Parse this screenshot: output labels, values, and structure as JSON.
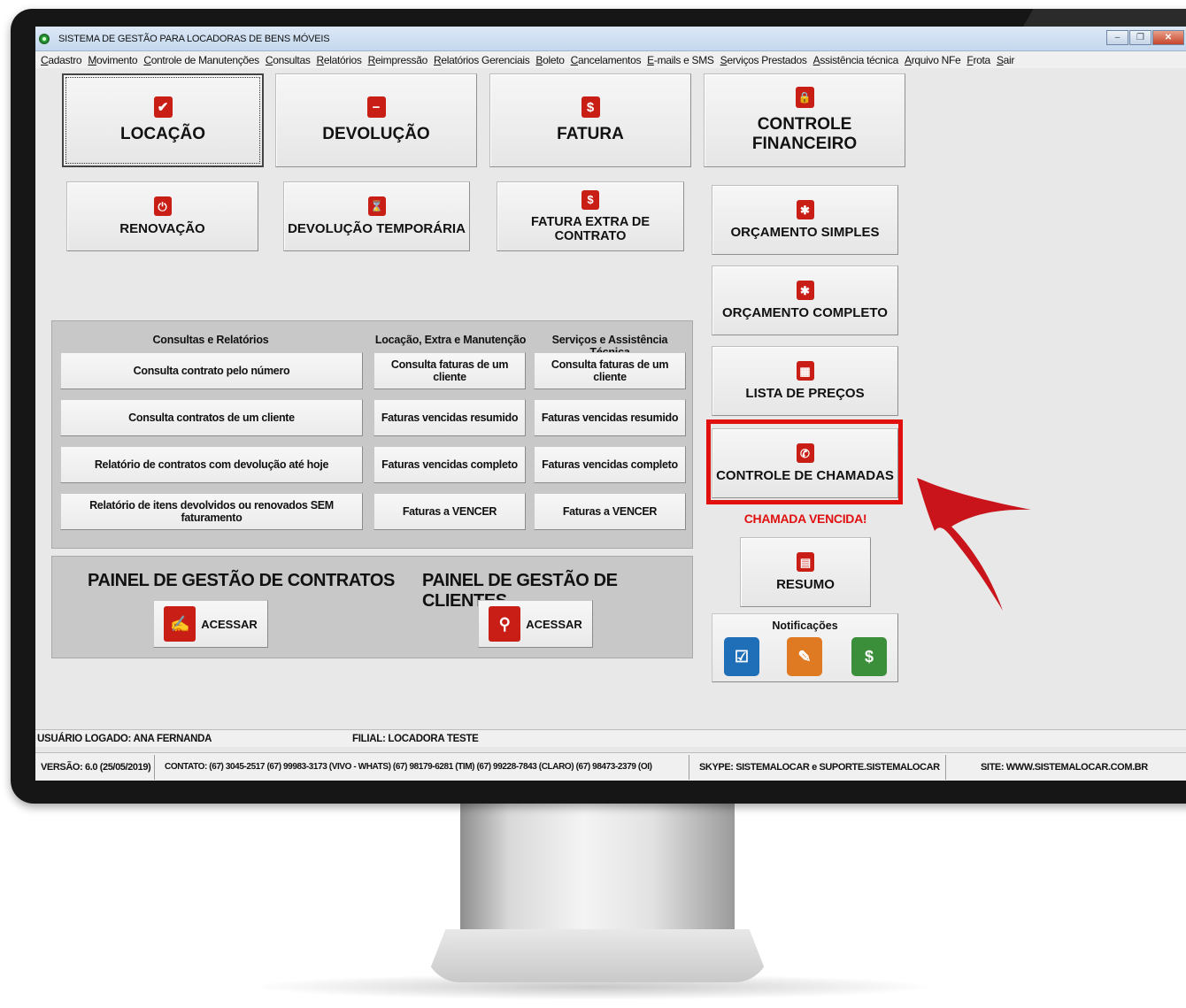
{
  "window": {
    "title": "SISTEMA DE GESTÃO PARA LOCADORAS DE BENS MÓVEIS",
    "controls": {
      "minimize": "–",
      "restore": "❐",
      "close": "✕"
    }
  },
  "menu": [
    "Cadastro",
    "Movimento",
    "Controle de Manutenções",
    "Consultas",
    "Relatórios",
    "Reimpressão",
    "Relatórios Gerenciais",
    "Boleto",
    "Cancelamentos",
    "E-mails e SMS",
    "Serviços Prestados",
    "Assistência técnica",
    "Arquivo NFe",
    "Frota",
    "Sair"
  ],
  "main_buttons": {
    "locacao": {
      "label": "LOCAÇÃO",
      "icon": "checkbox-icon",
      "glyph": "✔"
    },
    "devolucao": {
      "label": "DEVOLUÇÃO",
      "icon": "minus-icon",
      "glyph": "−"
    },
    "fatura": {
      "label": "FATURA",
      "icon": "dollar-icon",
      "glyph": "$"
    },
    "controle_financeiro": {
      "label": "CONTROLE FINANCEIRO",
      "icon": "lock-icon",
      "glyph": "🔒"
    },
    "renovacao": {
      "label": "RENOVAÇÃO",
      "icon": "power-icon",
      "glyph": "⏻"
    },
    "devolucao_temporaria": {
      "label": "DEVOLUÇÃO TEMPORÁRIA",
      "icon": "hourglass-icon",
      "glyph": "⌛"
    },
    "fatura_extra": {
      "label": "FATURA EXTRA DE CONTRATO",
      "icon": "dollar-icon",
      "glyph": "$"
    }
  },
  "side_buttons": {
    "orcamento_simples": {
      "label": "ORÇAMENTO SIMPLES",
      "icon": "gear-icon",
      "glyph": "✱"
    },
    "orcamento_completo": {
      "label": "ORÇAMENTO COMPLETO",
      "icon": "gear-icon",
      "glyph": "✱"
    },
    "lista_precos": {
      "label": "LISTA DE PREÇOS",
      "icon": "calculator-icon",
      "glyph": "▦"
    },
    "controle_chamadas": {
      "label": "CONTROLE DE CHAMADAS",
      "icon": "phone-icon",
      "glyph": "✆"
    },
    "chamada_alert": "CHAMADA VENCIDA!",
    "resumo": {
      "label": "RESUMO",
      "icon": "document-icon",
      "glyph": "▤"
    }
  },
  "notifications": {
    "title": "Notificações",
    "icons": [
      {
        "name": "checklist-icon",
        "color": "#1f6fb8",
        "glyph": "☑"
      },
      {
        "name": "edit-document-icon",
        "color": "#e07a22",
        "glyph": "✎"
      },
      {
        "name": "invoice-icon",
        "color": "#3c8f3a",
        "glyph": "$"
      }
    ]
  },
  "reports": {
    "headers": [
      "Consultas e Relatórios",
      "Locação, Extra e Manutenção",
      "Serviços e Assistência Técnica"
    ],
    "col1": [
      "Consulta contrato pelo número",
      "Consulta contratos de um cliente",
      "Relatório de contratos com devolução até hoje",
      "Relatório de itens devolvidos ou renovados SEM faturamento"
    ],
    "col2": [
      "Consulta faturas de um cliente",
      "Faturas vencidas resumido",
      "Faturas vencidas completo",
      "Faturas a VENCER"
    ],
    "col3": [
      "Consulta faturas de um cliente",
      "Faturas vencidas resumido",
      "Faturas vencidas completo",
      "Faturas a VENCER"
    ]
  },
  "panels": {
    "contratos": {
      "title": "PAINEL DE GESTÃO DE CONTRATOS",
      "button": "ACESSAR",
      "icon": "contract-icon"
    },
    "clientes": {
      "title": "PAINEL DE GESTÃO DE CLIENTES",
      "button": "ACESSAR",
      "icon": "clients-search-icon"
    }
  },
  "status": {
    "usuario": "USUÁRIO LOGADO: ANA FERNANDA",
    "filial": "FILIAL: LOCADORA TESTE",
    "versao": "VERSÃO: 6.0 (25/05/2019)",
    "contato": "CONTATO: (67) 3045-2517 (67) 99983-3173 (VIVO - WHATS)  (67) 98179-6281 (TIM) (67) 99228-7843 (CLARO) (67) 98473-2379 (OI)",
    "skype": "SKYPE: SISTEMALOCAR e SUPORTE.SISTEMALOCAR",
    "site": "SITE: WWW.SISTEMALOCAR.COM.BR"
  },
  "colors": {
    "accent_red": "#c81e15",
    "highlight": "#e20f0f",
    "alert_text": "#e01010"
  }
}
